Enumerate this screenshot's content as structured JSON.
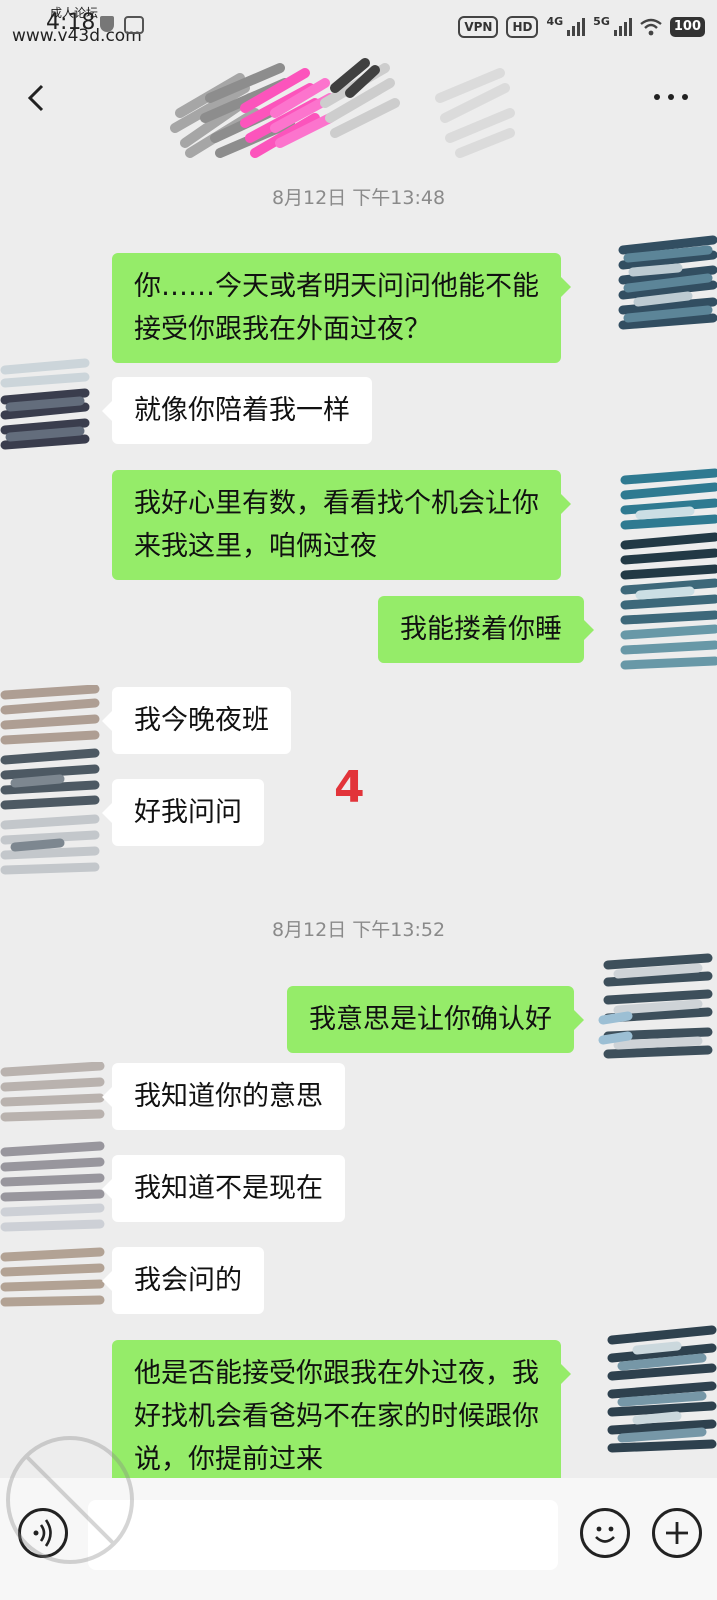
{
  "status_bar": {
    "time": "4:18",
    "forum_label": "成人论坛",
    "site_url": "www.v43d.com",
    "vpn": "VPN",
    "hd": "HD",
    "net1": "4G",
    "net2": "5G",
    "battery": "100"
  },
  "header": {
    "back_icon": "chevron-left-icon",
    "more_icon": "more-dots-icon"
  },
  "timestamps": [
    "8月12日 下午13:48",
    "8月12日 下午13:52"
  ],
  "messages": [
    {
      "side": "out",
      "lines": [
        "你……今天或者明天问问他能不能",
        "接受你跟我在外面过夜？"
      ]
    },
    {
      "side": "in",
      "lines": [
        "就像你陪着我一样"
      ]
    },
    {
      "side": "out",
      "lines": [
        "我好心里有数，看看找个机会让你",
        "来我这里，咱俩过夜"
      ]
    },
    {
      "side": "out",
      "lines": [
        "我能搂着你睡"
      ]
    },
    {
      "side": "in",
      "lines": [
        "我今晚夜班"
      ]
    },
    {
      "side": "in",
      "lines": [
        "好我问问"
      ]
    },
    {
      "side": "out",
      "lines": [
        "我意思是让你确认好"
      ]
    },
    {
      "side": "in",
      "lines": [
        "我知道你的意思"
      ]
    },
    {
      "side": "in",
      "lines": [
        "我知道不是现在"
      ]
    },
    {
      "side": "in",
      "lines": [
        "我会问的"
      ]
    },
    {
      "side": "out",
      "lines": [
        "他是否能接受你跟我在外过夜，我",
        "好找机会看爸妈不在家的时候跟你",
        "说，你提前过来"
      ]
    }
  ],
  "annotation_number": "4",
  "input_bar": {
    "voice_icon": "voice-icon",
    "emoji_icon": "emoji-icon",
    "plus_icon": "plus-icon"
  },
  "colors": {
    "background": "#ededed",
    "bubble_out": "#95ec69",
    "bubble_in": "#ffffff",
    "timestamp": "#8a8a8a",
    "annotation": "#e2343a"
  }
}
